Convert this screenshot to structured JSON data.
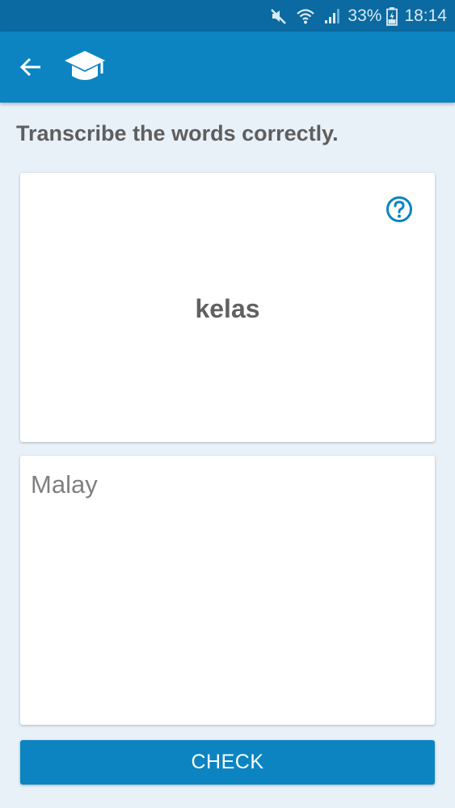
{
  "status_bar": {
    "battery": "33%",
    "time": "18:14",
    "icons": [
      "mute-icon",
      "wifi-icon",
      "signal-icon",
      "battery-icon"
    ]
  },
  "app_bar": {
    "icons": [
      "back-arrow-icon",
      "graduation-cap-icon"
    ]
  },
  "exercise": {
    "instruction": "Transcribe the words correctly.",
    "word": "kelas",
    "help_icon": "question-circle-icon"
  },
  "answer": {
    "value": "",
    "placeholder": "Malay"
  },
  "actions": {
    "check_label": "CHECK"
  },
  "colors": {
    "status_bar": "#0a6aa1",
    "primary": "#0c84c2",
    "background": "#e8f1f8",
    "card": "#ffffff",
    "text_dark": "#5e5e5e"
  }
}
